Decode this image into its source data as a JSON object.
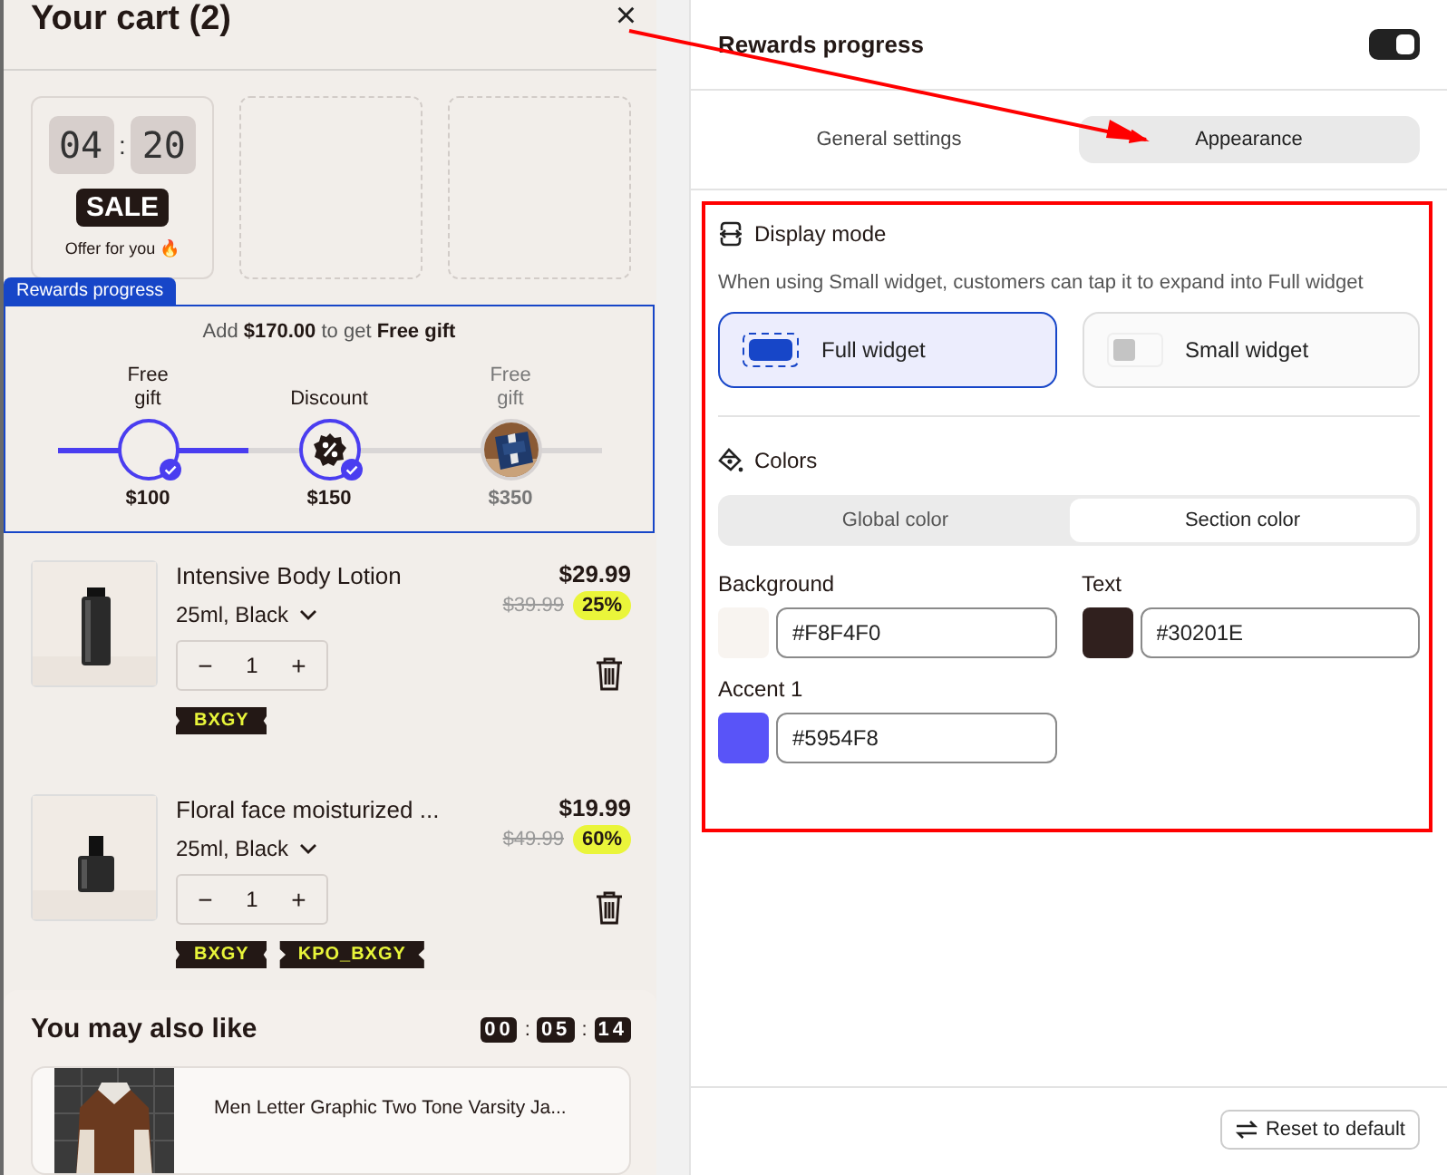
{
  "cart": {
    "title": "Your cart (2)",
    "close": "×",
    "offers": [
      {
        "kind": "timer",
        "minutes": "04",
        "separator": ":",
        "seconds": "20",
        "badge": "SALE",
        "caption": "Offer for you 🔥"
      },
      {
        "kind": "empty"
      },
      {
        "kind": "empty"
      }
    ],
    "rewards": {
      "tab": "Rewards progress",
      "message": "Add **$170.00** to get **Free gift**",
      "level": 0.35,
      "milestones": [
        {
          "kind": "empty",
          "label": "Free gift",
          "amount": "$100",
          "reached": true
        },
        {
          "kind": "discount",
          "label": "Discount",
          "amount": "$150",
          "reached": true
        },
        {
          "kind": "picture",
          "label": "Free gift",
          "amount": "$350",
          "reached": false
        }
      ]
    },
    "items": [
      {
        "name": "Intensive Body Lotion",
        "variant": "25ml, Black",
        "price": "$29.99",
        "compare_price": "$39.99",
        "discount": "25%",
        "minus": "−",
        "quantity": "1",
        "plus": "+",
        "tags": [
          "BXGY"
        ]
      },
      {
        "name": "Floral face moisturized ...",
        "variant": "25ml, Black",
        "price": "$19.99",
        "compare_price": "$49.99",
        "discount": "60%",
        "minus": "−",
        "quantity": "1",
        "plus": "+",
        "tags": [
          "BXGY",
          "KPO_BXGY"
        ]
      }
    ],
    "recommendations": {
      "title": "You may also like",
      "timer": [
        "00",
        "05",
        "14"
      ],
      "separator": ":",
      "products": [
        {
          "name": "Men Letter Graphic Two Tone Varsity Ja..."
        }
      ]
    }
  },
  "settings": {
    "title": "Rewards progress",
    "enabled": true,
    "tabs": [
      {
        "label": "General settings",
        "selected": false
      },
      {
        "label": "Appearance",
        "selected": true
      }
    ],
    "display_mode": {
      "title": "Display mode",
      "description": "When using Small widget, customers can tap it to expand into Full widget",
      "options": [
        {
          "label": "Full widget",
          "selected": true
        },
        {
          "label": "Small widget",
          "selected": false
        }
      ]
    },
    "colors": {
      "title": "Colors",
      "scopes": [
        {
          "label": "Global color",
          "selected": false
        },
        {
          "label": "Section color",
          "selected": true
        }
      ],
      "fields": [
        {
          "label": "Background",
          "value": "#F8F4F0",
          "color": "#f8f4f0"
        },
        {
          "label": "Text",
          "value": "#30201E",
          "color": "#30201e"
        },
        {
          "label": "Accent 1",
          "value": "#5954F8",
          "color": "#5954f8"
        }
      ]
    },
    "reset_button": "Reset to default"
  }
}
